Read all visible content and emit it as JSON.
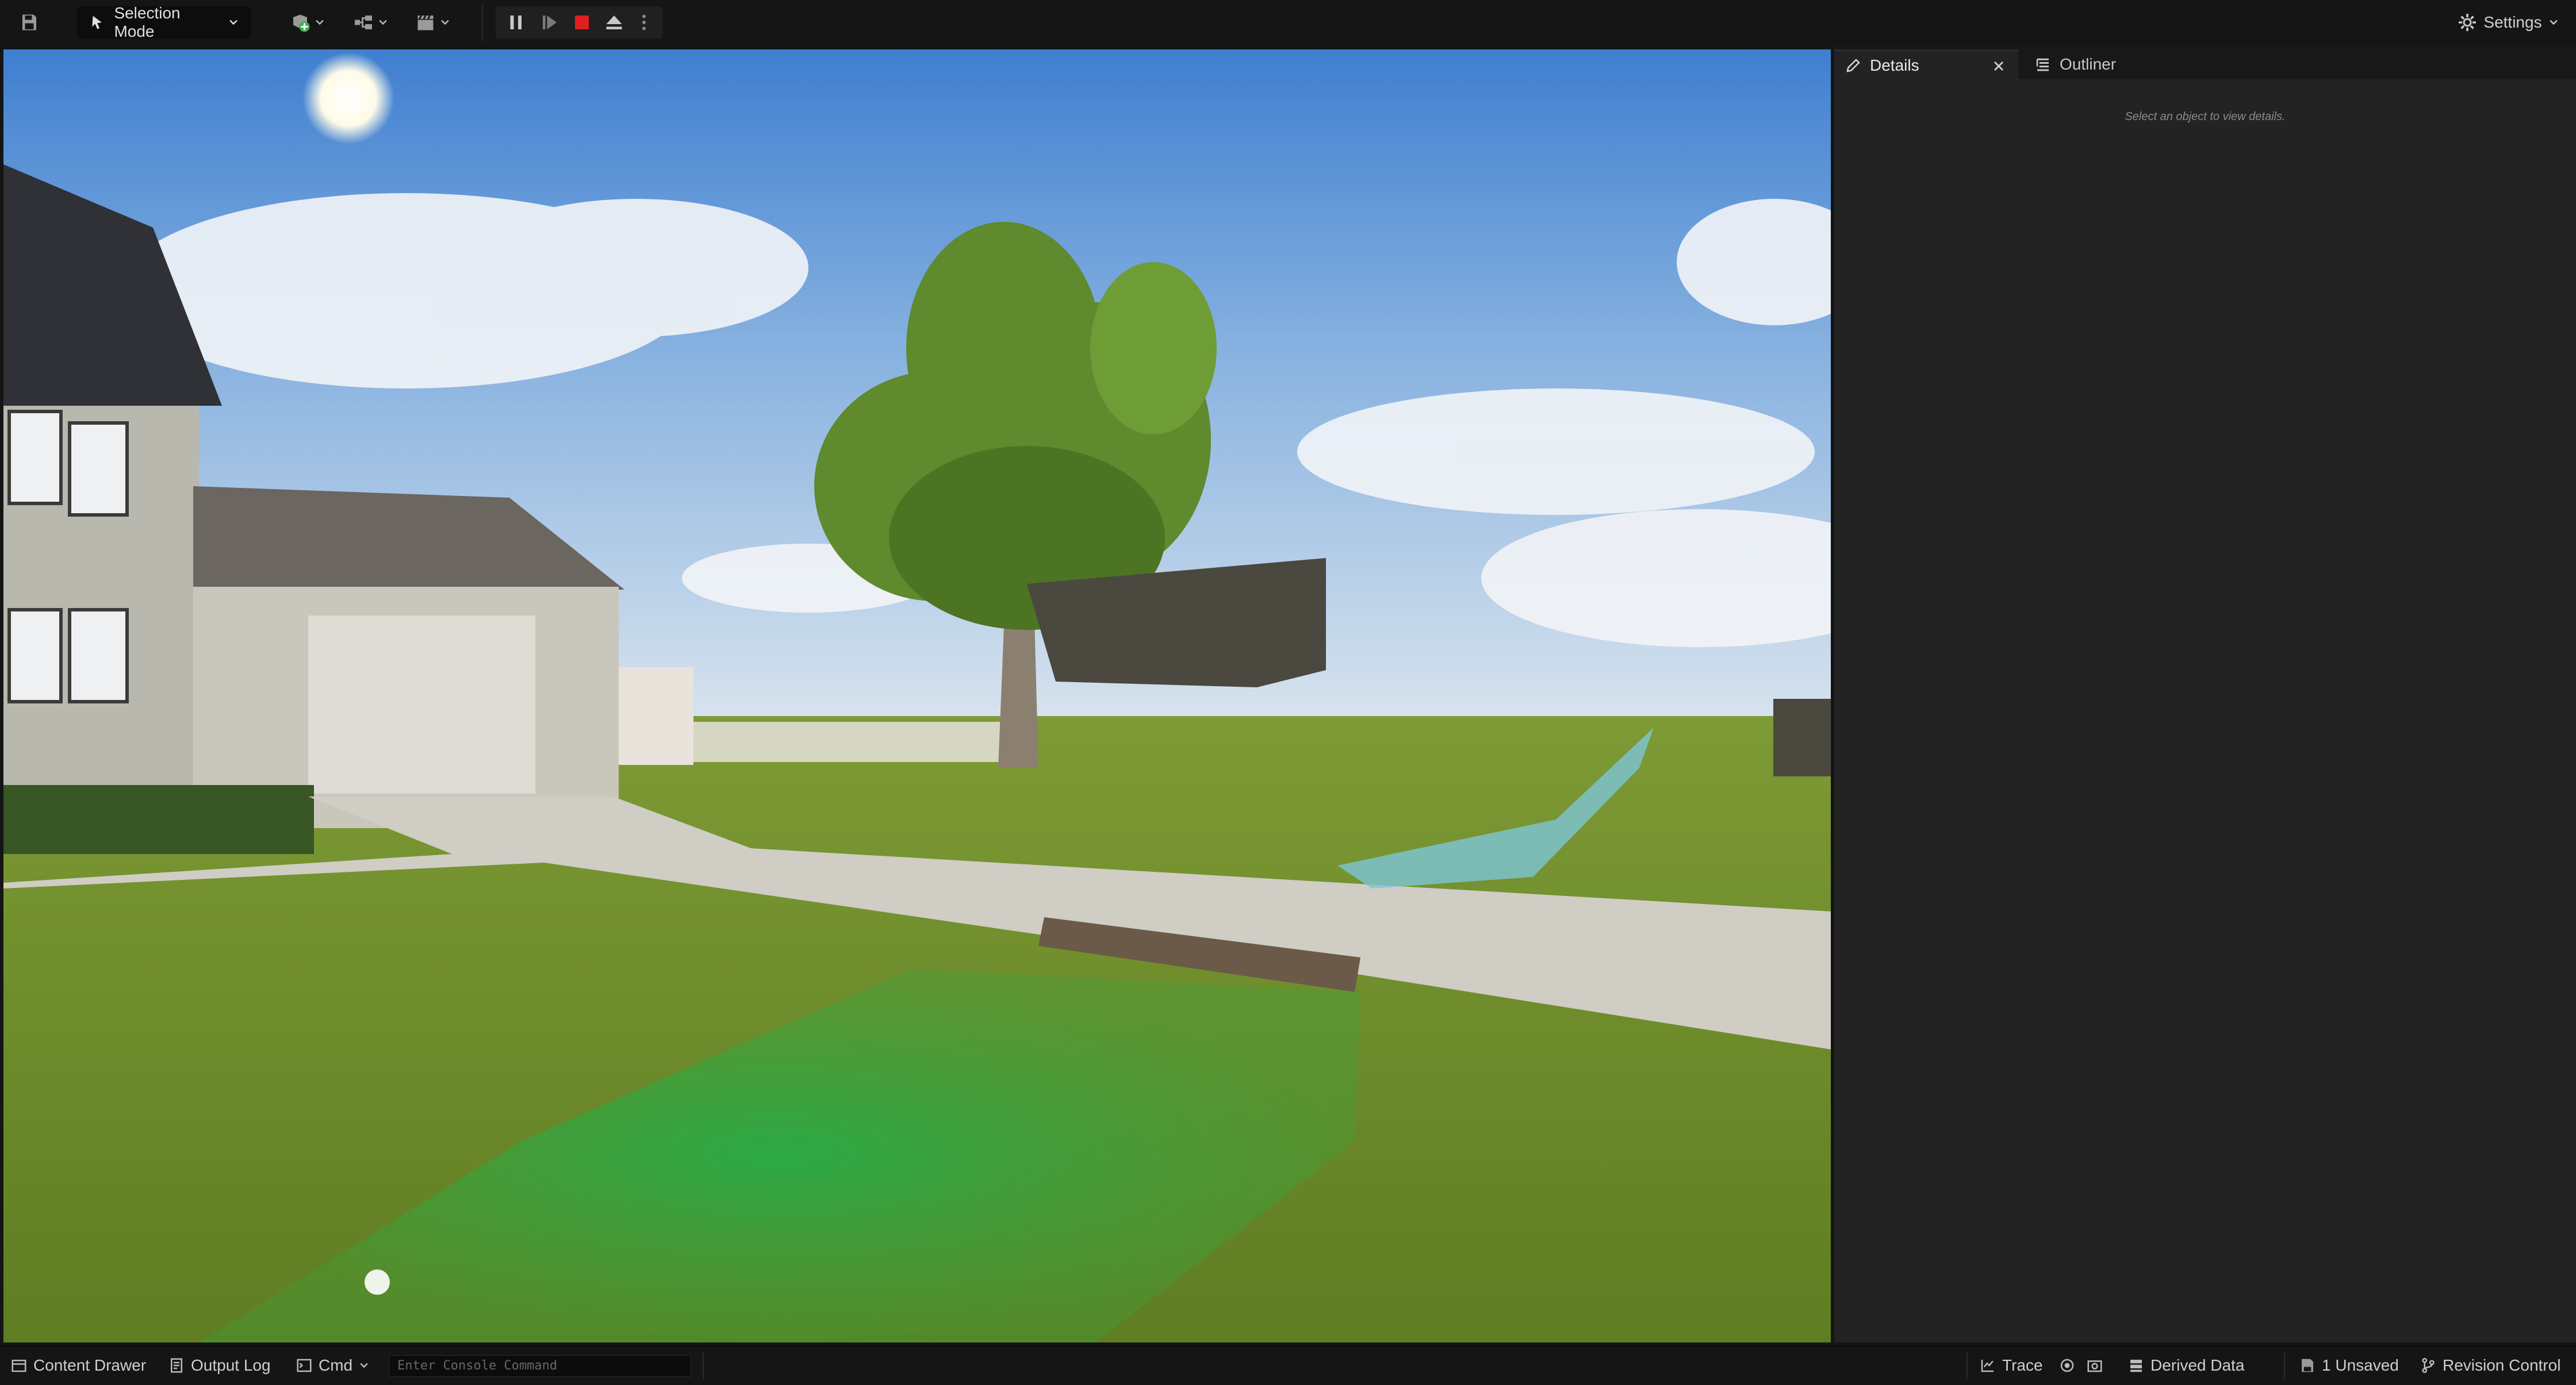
{
  "toolbar": {
    "save_icon": "save-icon",
    "selection_mode_label": "Selection Mode",
    "add_icon": "add-actor-icon",
    "blueprint_icon": "blueprint-icon",
    "cinematics_icon": "clapperboard-icon",
    "play_controls": [
      "pause-icon",
      "frame-advance-icon",
      "stop-icon",
      "eject-icon",
      "more-options-icon"
    ],
    "settings_label": "Settings",
    "stop_color": "#e02020"
  },
  "panel": {
    "tabs": [
      {
        "label": "Details",
        "icon": "pencil-icon",
        "active": true
      },
      {
        "label": "Outliner",
        "icon": "outliner-icon",
        "active": false
      }
    ],
    "empty_message": "Select an object to view details."
  },
  "statusbar": {
    "content_drawer": "Content Drawer",
    "output_log": "Output Log",
    "cmd": "Cmd",
    "console_placeholder": "Enter Console Command",
    "trace": "Trace",
    "derived_data": "Derived Data",
    "unsaved": "1 Unsaved",
    "revision_control": "Revision Control"
  },
  "viewport": {
    "accent_green": "#2fa64a",
    "sky_top": "#3f7fd0"
  }
}
